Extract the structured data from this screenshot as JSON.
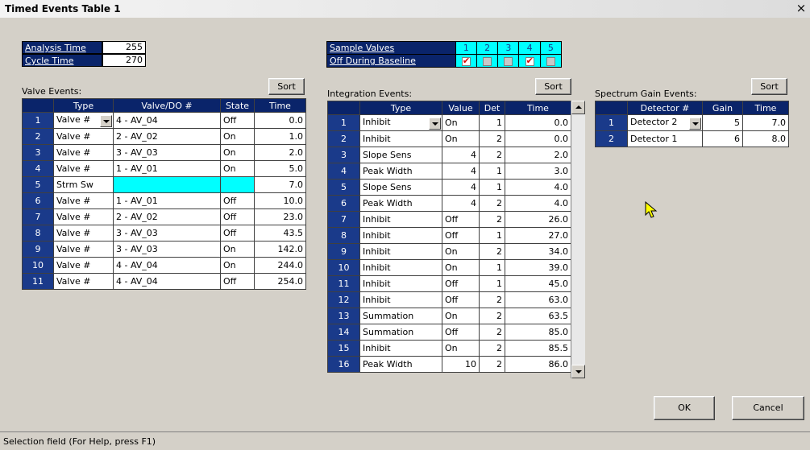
{
  "window": {
    "title": "Timed Events Table 1",
    "close_glyph": "×"
  },
  "analysis": {
    "analysis_time_label": "Analysis Time",
    "analysis_time_value": "255",
    "cycle_time_label": "Cycle Time",
    "cycle_time_value": "270"
  },
  "sample_valves": {
    "label": "Sample Valves",
    "off_label": "Off During Baseline",
    "numbers": [
      "1",
      "2",
      "3",
      "4",
      "5"
    ],
    "checked": [
      true,
      false,
      false,
      true,
      false
    ]
  },
  "valve_events": {
    "title": "Valve Events:",
    "sort_label": "Sort",
    "headers": [
      "Type",
      "Valve/DO #",
      "State",
      "Time"
    ],
    "rows": [
      [
        "1",
        "Valve #",
        "4 - AV_04",
        "Off",
        "0.0"
      ],
      [
        "2",
        "Valve #",
        "2 - AV_02",
        "On",
        "1.0"
      ],
      [
        "3",
        "Valve #",
        "3 - AV_03",
        "On",
        "2.0"
      ],
      [
        "4",
        "Valve #",
        "1 - AV_01",
        "On",
        "5.0"
      ],
      [
        "5",
        "Strm Sw",
        "",
        "",
        "7.0"
      ],
      [
        "6",
        "Valve #",
        "1 - AV_01",
        "Off",
        "10.0"
      ],
      [
        "7",
        "Valve #",
        "2 - AV_02",
        "Off",
        "23.0"
      ],
      [
        "8",
        "Valve #",
        "3 - AV_03",
        "Off",
        "43.5"
      ],
      [
        "9",
        "Valve #",
        "3 - AV_03",
        "On",
        "142.0"
      ],
      [
        "10",
        "Valve #",
        "4 - AV_04",
        "On",
        "244.0"
      ],
      [
        "11",
        "Valve #",
        "4 - AV_04",
        "Off",
        "254.0"
      ]
    ]
  },
  "integration_events": {
    "title": "Integration Events:",
    "sort_label": "Sort",
    "headers": [
      "Type",
      "Value",
      "Det",
      "Time"
    ],
    "rows": [
      [
        "1",
        "Inhibit",
        "On",
        "1",
        "0.0"
      ],
      [
        "2",
        "Inhibit",
        "On",
        "2",
        "0.0"
      ],
      [
        "3",
        "Slope Sens",
        "4",
        "2",
        "2.0"
      ],
      [
        "4",
        "Peak Width",
        "4",
        "1",
        "3.0"
      ],
      [
        "5",
        "Slope Sens",
        "4",
        "1",
        "4.0"
      ],
      [
        "6",
        "Peak Width",
        "4",
        "2",
        "4.0"
      ],
      [
        "7",
        "Inhibit",
        "Off",
        "2",
        "26.0"
      ],
      [
        "8",
        "Inhibit",
        "Off",
        "1",
        "27.0"
      ],
      [
        "9",
        "Inhibit",
        "On",
        "2",
        "34.0"
      ],
      [
        "10",
        "Inhibit",
        "On",
        "1",
        "39.0"
      ],
      [
        "11",
        "Inhibit",
        "Off",
        "1",
        "45.0"
      ],
      [
        "12",
        "Inhibit",
        "Off",
        "2",
        "63.0"
      ],
      [
        "13",
        "Summation",
        "On",
        "2",
        "63.5"
      ],
      [
        "14",
        "Summation",
        "Off",
        "2",
        "85.0"
      ],
      [
        "15",
        "Inhibit",
        "On",
        "2",
        "85.5"
      ],
      [
        "16",
        "Peak Width",
        "10",
        "2",
        "86.0"
      ]
    ]
  },
  "spectrum_gain_events": {
    "title": "Spectrum Gain Events:",
    "sort_label": "Sort",
    "headers": [
      "Detector #",
      "Gain",
      "Time"
    ],
    "rows": [
      [
        "1",
        "Detector 2",
        "5",
        "7.0"
      ],
      [
        "2",
        "Detector 1",
        "6",
        "8.0"
      ]
    ]
  },
  "buttons": {
    "ok": "OK",
    "cancel": "Cancel"
  },
  "status_bar": "Selection field (For Help, press F1)"
}
